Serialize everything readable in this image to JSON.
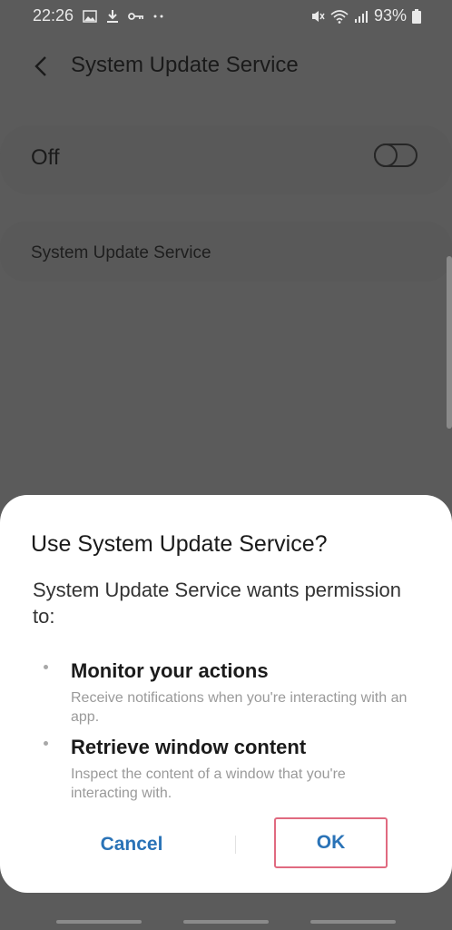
{
  "status_bar": {
    "time": "22:26",
    "battery": "93%",
    "icons_left": [
      "image-icon",
      "download-icon",
      "key-icon",
      "more-dots-icon"
    ],
    "icons_right": [
      "mute-icon",
      "wifi-icon",
      "signal-icon",
      "battery-icon"
    ]
  },
  "appbar": {
    "title": "System Update Service"
  },
  "toggle_card": {
    "label": "Off",
    "switch_on": false
  },
  "description_card": {
    "label": "System Update Service"
  },
  "dialog": {
    "title": "Use System Update Service?",
    "message": "System Update Service wants permission to:",
    "permissions": [
      {
        "title": "Monitor your actions",
        "description": "Receive notifications when you're interacting with an app."
      },
      {
        "title": "Retrieve window content",
        "description": "Inspect the content of a window that you're interacting with."
      }
    ],
    "cancel_label": "Cancel",
    "ok_label": "OK"
  },
  "colors": {
    "scrim": "#5b5b5b",
    "dialog_bg": "#ffffff",
    "accent": "#2a73b7",
    "focus_border": "#e06a80"
  }
}
